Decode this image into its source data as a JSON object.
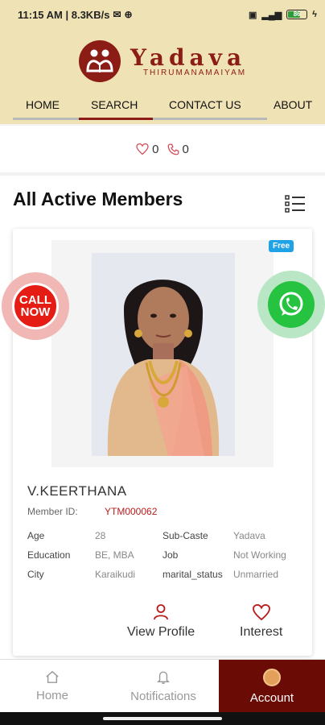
{
  "status_bar": {
    "time_speed": "11:15 AM | 8.3KB/s",
    "battery": "86"
  },
  "header": {
    "brand_name": "Yadava",
    "brand_subtitle": "THIRUMANAMAIYAM",
    "nav": [
      {
        "label": "HOME",
        "active": false
      },
      {
        "label": "SEARCH",
        "active": true
      },
      {
        "label": "CONTACT US",
        "active": false
      },
      {
        "label": "ABOUT",
        "active": false
      }
    ]
  },
  "counters": {
    "interest_count": "0",
    "call_count": "0"
  },
  "page": {
    "title": "All Active Members"
  },
  "member": {
    "badge": "Free",
    "name": "V.KEERTHANA",
    "member_id_label": "Member ID:",
    "member_id": "YTM000062",
    "fields": [
      {
        "label": "Age",
        "value": "28"
      },
      {
        "label": "Sub-Caste",
        "value": "Yadava"
      },
      {
        "label": "Education",
        "value": "BE, MBA"
      },
      {
        "label": "Job",
        "value": "Not Working"
      },
      {
        "label": "City",
        "value": "Karaikudi"
      },
      {
        "label": "marital_status",
        "value": "Unmarried"
      }
    ],
    "actions": {
      "view_profile": "View Profile",
      "interest": "Interest"
    }
  },
  "floating": {
    "call_line1": "CALL",
    "call_line2": "NOW"
  },
  "bottom_nav": {
    "home": "Home",
    "notifications": "Notifications",
    "account": "Account"
  },
  "colors": {
    "header_bg": "#efe3b6",
    "brand": "#8c1c16",
    "account_bg": "#6b0b06",
    "member_id": "#b81c1c",
    "badge": "#1fa2e6"
  }
}
